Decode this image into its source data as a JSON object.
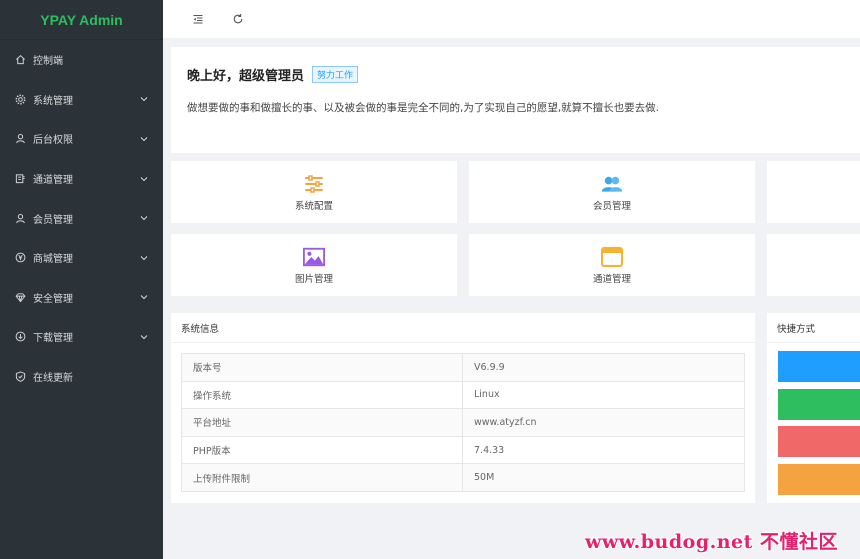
{
  "app": {
    "title": "YPAY Admin"
  },
  "colors": {
    "brand": "#2ebd5f",
    "sidebar_bg": "#2b3338",
    "accent_blue": "#1e9fff"
  },
  "sidebar": {
    "items": [
      {
        "label": "控制端",
        "icon": "home-icon",
        "expandable": false
      },
      {
        "label": "系统管理",
        "icon": "gear-icon",
        "expandable": true
      },
      {
        "label": "后台权限",
        "icon": "user-icon",
        "expandable": true
      },
      {
        "label": "通道管理",
        "icon": "channel-icon",
        "expandable": true
      },
      {
        "label": "会员管理",
        "icon": "user-icon",
        "expandable": true
      },
      {
        "label": "商城管理",
        "icon": "yen-icon",
        "expandable": true
      },
      {
        "label": "安全管理",
        "icon": "diamond-icon",
        "expandable": true
      },
      {
        "label": "下载管理",
        "icon": "download-icon",
        "expandable": true
      },
      {
        "label": "在线更新",
        "icon": "shield-check-icon",
        "expandable": false
      }
    ]
  },
  "topbar": {
    "icons": [
      "menu-fold-icon",
      "refresh-icon"
    ]
  },
  "welcome": {
    "greeting": "晚上好，超级管理员",
    "tag": "努力工作",
    "motto": "做想要做的事和做擅长的事、以及被会做的事是完全不同的,为了实现自己的愿望,就算不擅长也要去做."
  },
  "quick_cards": [
    {
      "label": "系统配置",
      "icon": "sliders-icon",
      "color": "#f5a340"
    },
    {
      "label": "会员管理",
      "icon": "users-icon",
      "color": "#3ba8e8"
    },
    {
      "label": "图片管理",
      "icon": "image-icon",
      "color": "#9b59e8"
    },
    {
      "label": "通道管理",
      "icon": "window-icon",
      "color": "#f7b22f"
    }
  ],
  "system_info": {
    "title": "系统信息",
    "rows": [
      {
        "key": "版本号",
        "value": "V6.9.9"
      },
      {
        "key": "操作系统",
        "value": "Linux"
      },
      {
        "key": "平台地址",
        "value": "www.atyzf.cn"
      },
      {
        "key": "PHP版本",
        "value": "7.4.33"
      },
      {
        "key": "上传附件限制",
        "value": "50M"
      }
    ]
  },
  "shortcuts": {
    "title": "快捷方式",
    "buttons": [
      {
        "color": "#1e9fff"
      },
      {
        "color": "#2ebd5f"
      },
      {
        "color": "#f06868"
      },
      {
        "color": "#f5a340"
      }
    ]
  },
  "watermark": "www.budog.net 不懂社区"
}
